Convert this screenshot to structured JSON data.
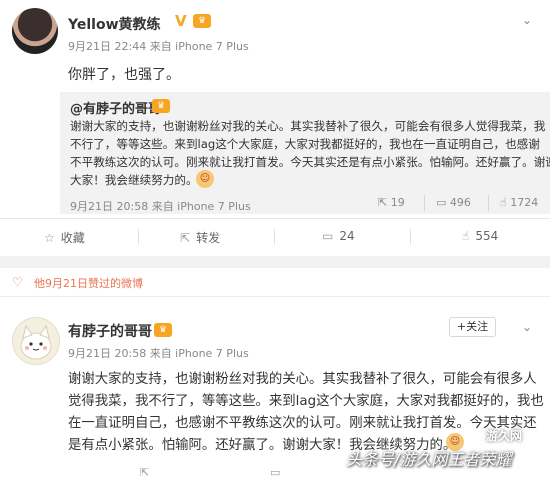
{
  "post1": {
    "author": "Yellow黄教练",
    "meta": "9月21日 22:44 来自 iPhone 7 Plus",
    "text": "你胖了，也强了。",
    "repost": {
      "author": "@有脖子的哥哥",
      "lines": [
        "谢谢大家的支持，也谢谢粉丝对我的关心。其实我替补了很久，可能会有很多人觉得我菜，我",
        "不行了，等等这些。来到lag这个大家庭，大家对我都挺好的，我也在一直证明自己，也感谢",
        "不平教练这次的认可。刚来就让我打首发。今天其实还是有点小紧张。怕输阿。还好赢了。谢谢",
        "大家！我会继续努力的。"
      ],
      "meta": "9月21日 20:58 来自 iPhone 7 Plus",
      "reposts": "19",
      "comments": "496",
      "likes": "1724"
    },
    "actions": {
      "favorite": "收藏",
      "repost": "转发",
      "comment": "24",
      "like": "554"
    }
  },
  "liked_bar": {
    "text": "他9月21日赞过的微博"
  },
  "post2": {
    "author": "有脖子的哥哥",
    "meta": "9月21日 20:58 来自 iPhone 7 Plus",
    "follow": "+关注",
    "lines": [
      "谢谢大家的支持，也谢谢粉丝对我的关心。其实我替补了很久，可能会有很多人",
      "觉得我菜，我不行了，等等这些。来到lag这个大家庭，大家对我都挺好的，我也",
      "在一直证明自己，也感谢不平教练这次的认可。刚来就让我打首发。今天其实还",
      "是有点小紧张。怕输阿。还好赢了。谢谢大家！我会继续努力的。"
    ]
  },
  "watermark": {
    "text": "头条号/游久网王者荣耀",
    "logo": "游久网"
  },
  "colors": {
    "accent": "#eb7350",
    "vip": "#f6a623"
  }
}
